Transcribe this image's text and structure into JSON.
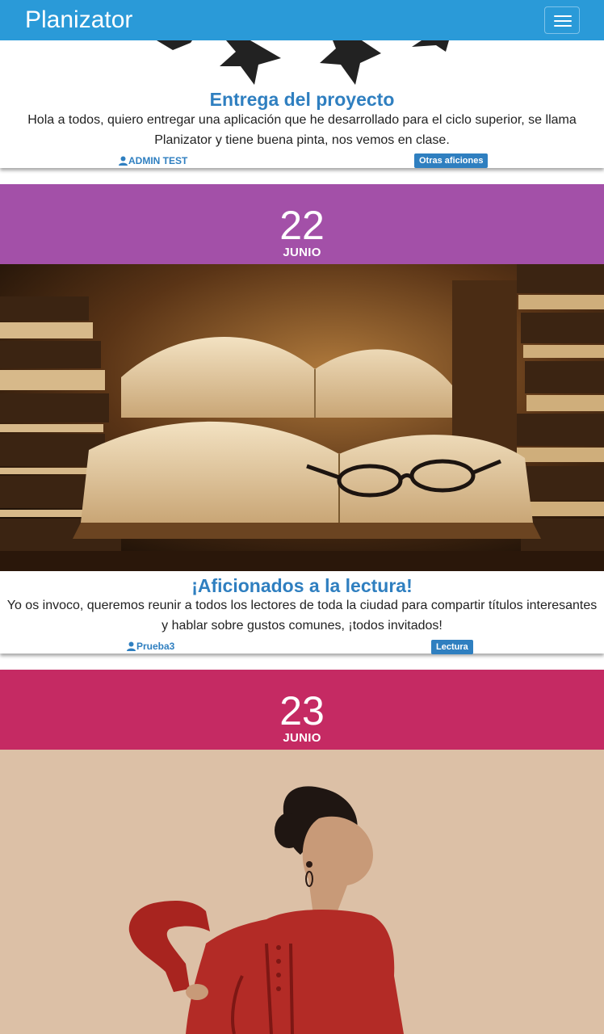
{
  "app": {
    "brand": "Planizator"
  },
  "colors": {
    "navbar": "#2a9ad8",
    "title": "#2f7fc0",
    "band_june22": "#a350a8",
    "band_june23": "#c52a63"
  },
  "posts": [
    {
      "title": "Entrega del proyecto",
      "description": "Hola a todos, quiero entregar una aplicación que he desarrollado para el ciclo superior, se llama Planizator y tiene buena pinta, nos vemos en clase.",
      "author": "ADMIN TEST",
      "tag": "Otras aficiones",
      "image": "stars-icon"
    },
    {
      "day": "22",
      "month": "JUNIO",
      "title": "¡Aficionados a la lectura!",
      "description": "Yo os invoco, queremos reunir a todos los lectores de toda la ciudad para compartir títulos interesantes y hablar sobre gustos comunes, ¡todos invitados!",
      "author": "Prueba3",
      "tag": "Lectura",
      "image": "open-books-with-glasses"
    },
    {
      "day": "23",
      "month": "JUNIO",
      "image": "flamenco-dancer-red-dress"
    }
  ]
}
